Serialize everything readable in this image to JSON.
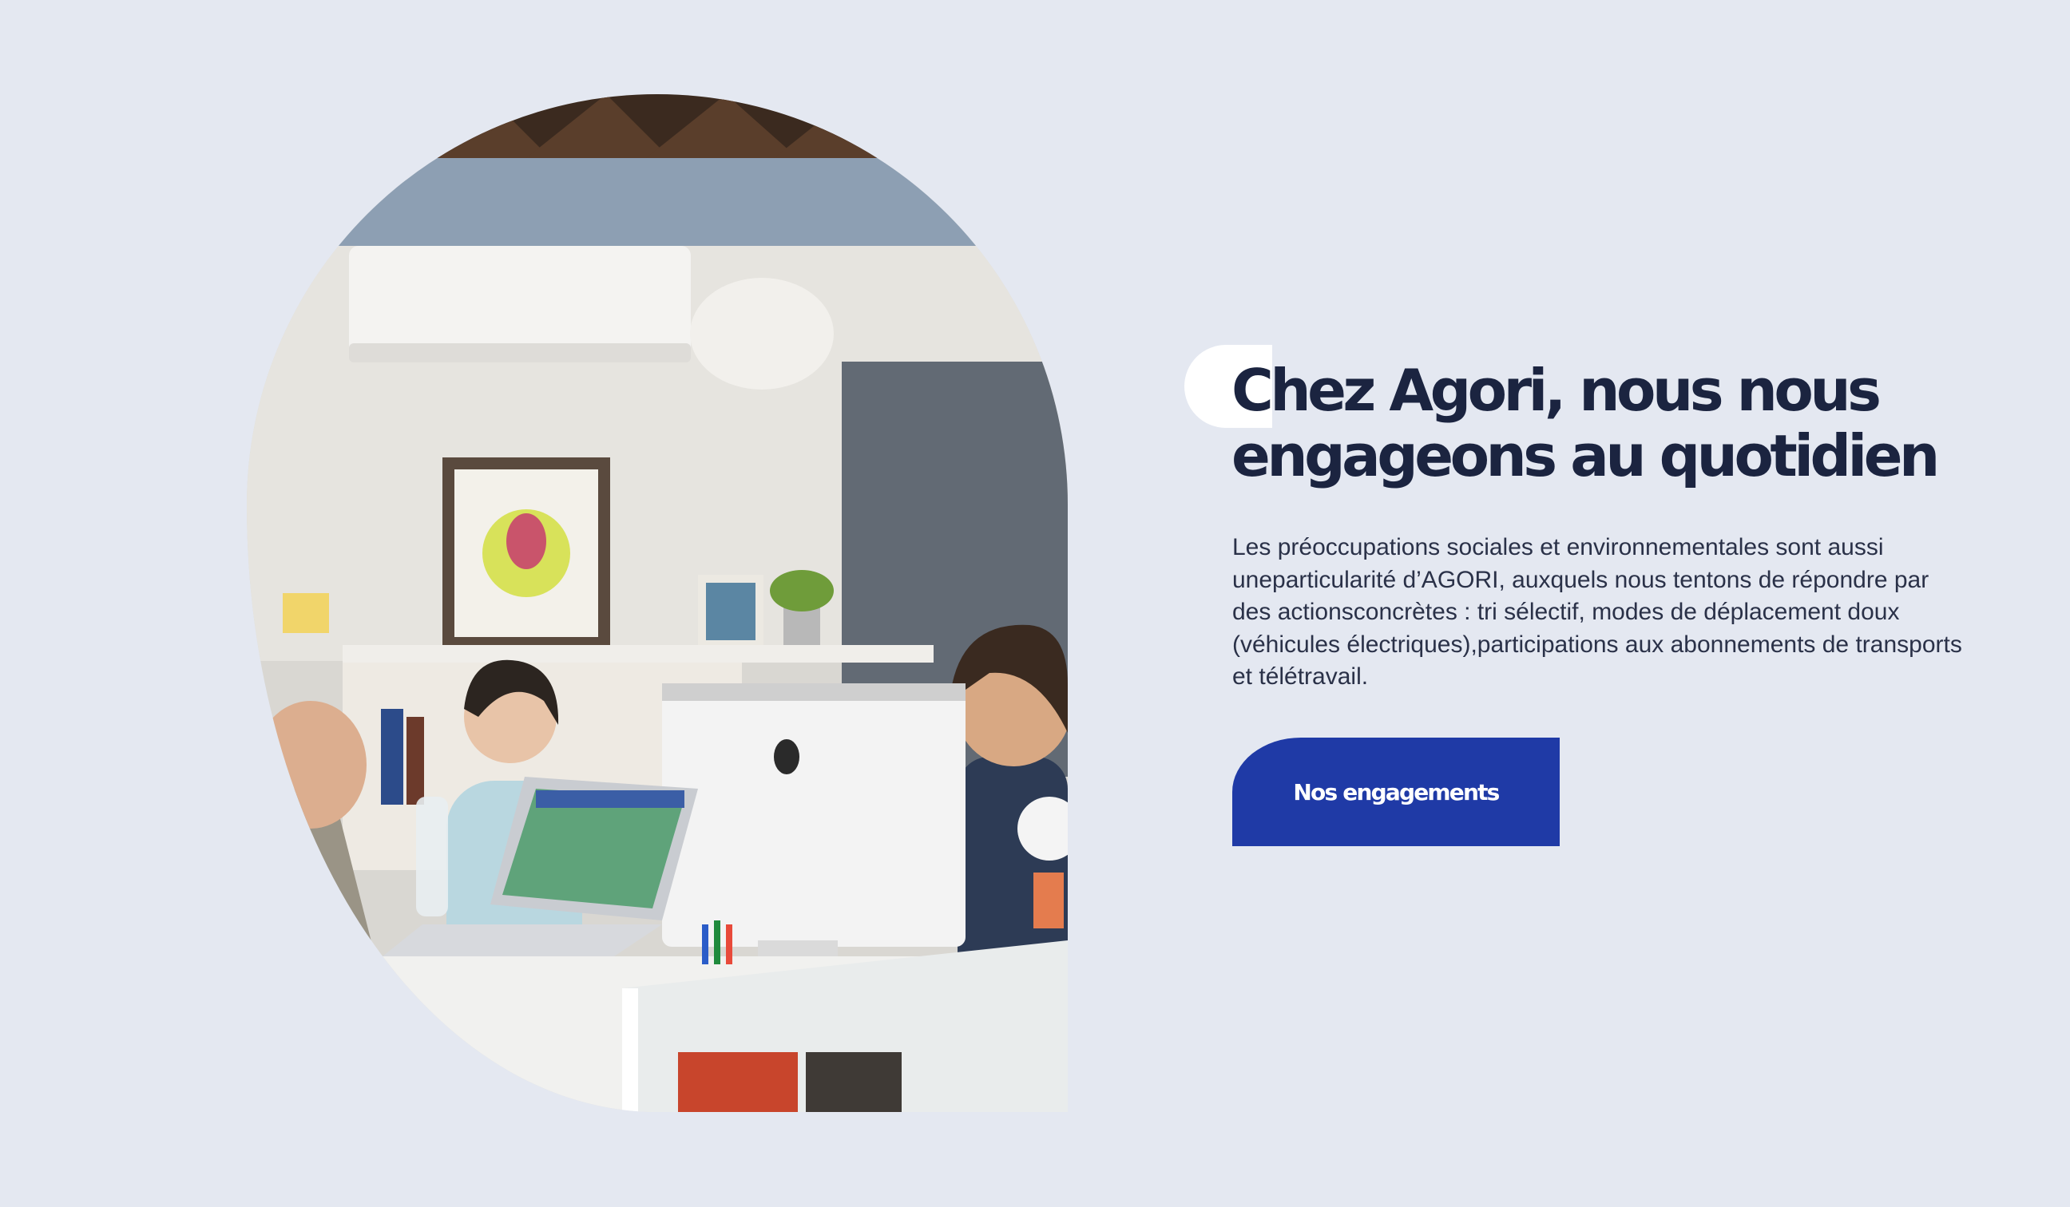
{
  "colors": {
    "page_background": "#e4e8f1",
    "heading": "#1b2440",
    "body_text": "#2a3148",
    "button_background": "#1f3aa6",
    "button_text": "#ffffff",
    "decor_pill": "#ffffff"
  },
  "hero": {
    "headline": "Chez Agori, nous nous engageons au quotidien",
    "body": "Les préoccupations sociales et environnementales sont aussi uneparticularité d’AGORI, auxquels nous tentons de répondre par des actionsconcrètes : tri sélectif, modes de déplacement doux (véhicules électriques),participations aux abonnements de transports et télétravail.",
    "cta_label": "Nos engagements"
  }
}
